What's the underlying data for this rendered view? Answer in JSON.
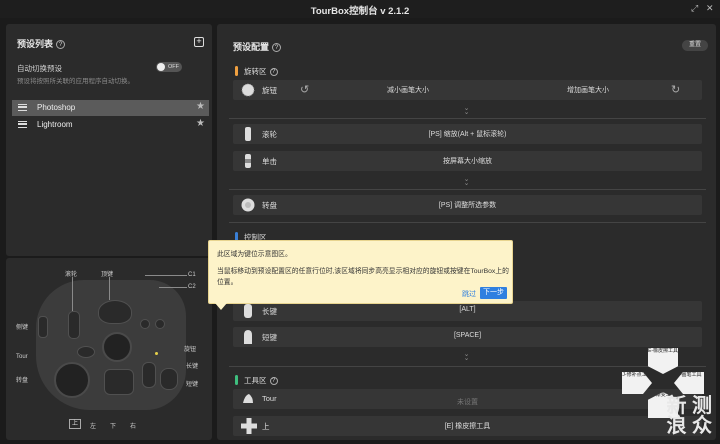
{
  "window": {
    "title": "TourBox控制台 v 2.1.2"
  },
  "presets_panel": {
    "title": "预设列表",
    "auto_switch_label": "自动切换预设",
    "auto_switch_desc": "预设将按照所关联的应用程序自动切换。",
    "toggle_text": "OFF",
    "items": [
      {
        "name": "Photoshop",
        "active": true
      },
      {
        "name": "Lightroom",
        "active": false
      }
    ]
  },
  "device_diagram": {
    "labels": {
      "roller": "滚轮",
      "side": "侧键",
      "top": "顶键",
      "c1": "C1",
      "c2": "C2",
      "knob": "旋钮",
      "tour": "Tour",
      "dial": "转盘",
      "long": "长键",
      "short": "短键",
      "up": "上",
      "left": "左",
      "down": "下",
      "right": "右"
    }
  },
  "config_panel": {
    "title": "预设配置",
    "reset_label": "重置",
    "sections": {
      "rotate": {
        "title": "旋转区",
        "color": "#f0a040",
        "knob_name": "旋钮",
        "knob_left": "减小画笔大小",
        "knob_right": "增加画笔大小",
        "roller_name": "滚轮",
        "roller_value": "[PS] 缩放(Alt + 鼠标滚轮)",
        "click_name": "单击",
        "click_value": "按屏幕大小缩放",
        "dial_name": "转盘",
        "dial_value": "[PS] 调整所选参数"
      },
      "control": {
        "title": "控制区",
        "color": "#3a7fd5",
        "long_name": "长键",
        "long_value": "[ALT]",
        "short_name": "短键",
        "short_value": "[SPACE]"
      },
      "tool": {
        "title": "工具区",
        "color": "#3fbf7f",
        "tour_name": "Tour",
        "tour_value": "未设置",
        "up_name": "上",
        "up_value": "[E] 橡皮擦工具"
      }
    }
  },
  "tooltip": {
    "title": "此区域为键位示意图区。",
    "body": "当鼠标移动到预设配置区的任意行位时,该区域将同步高亮显示相对应的旋钮或按键在TourBox上的位置。",
    "skip_label": "跳过",
    "next_label": "下一步"
  },
  "dpad_overlay": {
    "up": "E-橡皮擦工具",
    "left": "J-修补点工具",
    "right": "B-画笔工具",
    "down": "G-渐变工具"
  },
  "watermark": {
    "line1": "新 测",
    "line2": "浪 众"
  }
}
